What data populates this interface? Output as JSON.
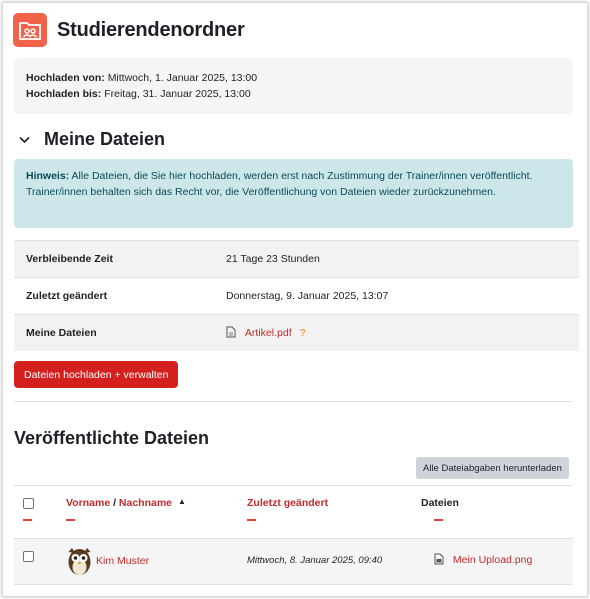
{
  "header": {
    "title": "Studierendenordner",
    "icon": "student-folder-icon",
    "accent": "#f0624a"
  },
  "dates": {
    "from_label": "Hochladen von:",
    "from_value": "Mittwoch, 1. Januar 2025, 13:00",
    "to_label": "Hochladen bis:",
    "to_value": "Freitag, 31. Januar 2025, 13:00"
  },
  "my_files": {
    "section_title": "Meine Dateien",
    "notice_label": "Hinweis:",
    "notice_text": "Alle Dateien, die Sie hier hochladen, werden erst nach Zustimmung der Trainer/innen veröffentlicht.",
    "notice_text2": "Trainer/innen behalten sich das Recht vor, die Veröffentlichung von Dateien wieder zurückzunehmen.",
    "rows": [
      {
        "label": "Verbleibende Zeit",
        "value": "21 Tage 23 Stunden"
      },
      {
        "label": "Zuletzt geändert",
        "value": "Donnerstag, 9. Januar 2025, 13:07"
      },
      {
        "label": "Meine Dateien",
        "file": "Artikel.pdf",
        "help": "?"
      }
    ],
    "upload_button": "Dateien hochladen + verwalten"
  },
  "published": {
    "title": "Veröffentlichte Dateien",
    "download_all": "Alle Dateiabgaben herunterladen",
    "columns": {
      "firstname": "Vorname",
      "separator": " / ",
      "lastname": "Nachname",
      "modified": "Zuletzt geändert",
      "files": "Dateien"
    },
    "rows": [
      {
        "name": "Kim Muster",
        "modified": "Mittwoch, 8. Januar 2025, 09:40",
        "file": "Mein Upload.png"
      }
    ]
  },
  "colors": {
    "primary": "#d3201f",
    "link": "#c22b2b",
    "notice_bg": "#cce6ea"
  }
}
